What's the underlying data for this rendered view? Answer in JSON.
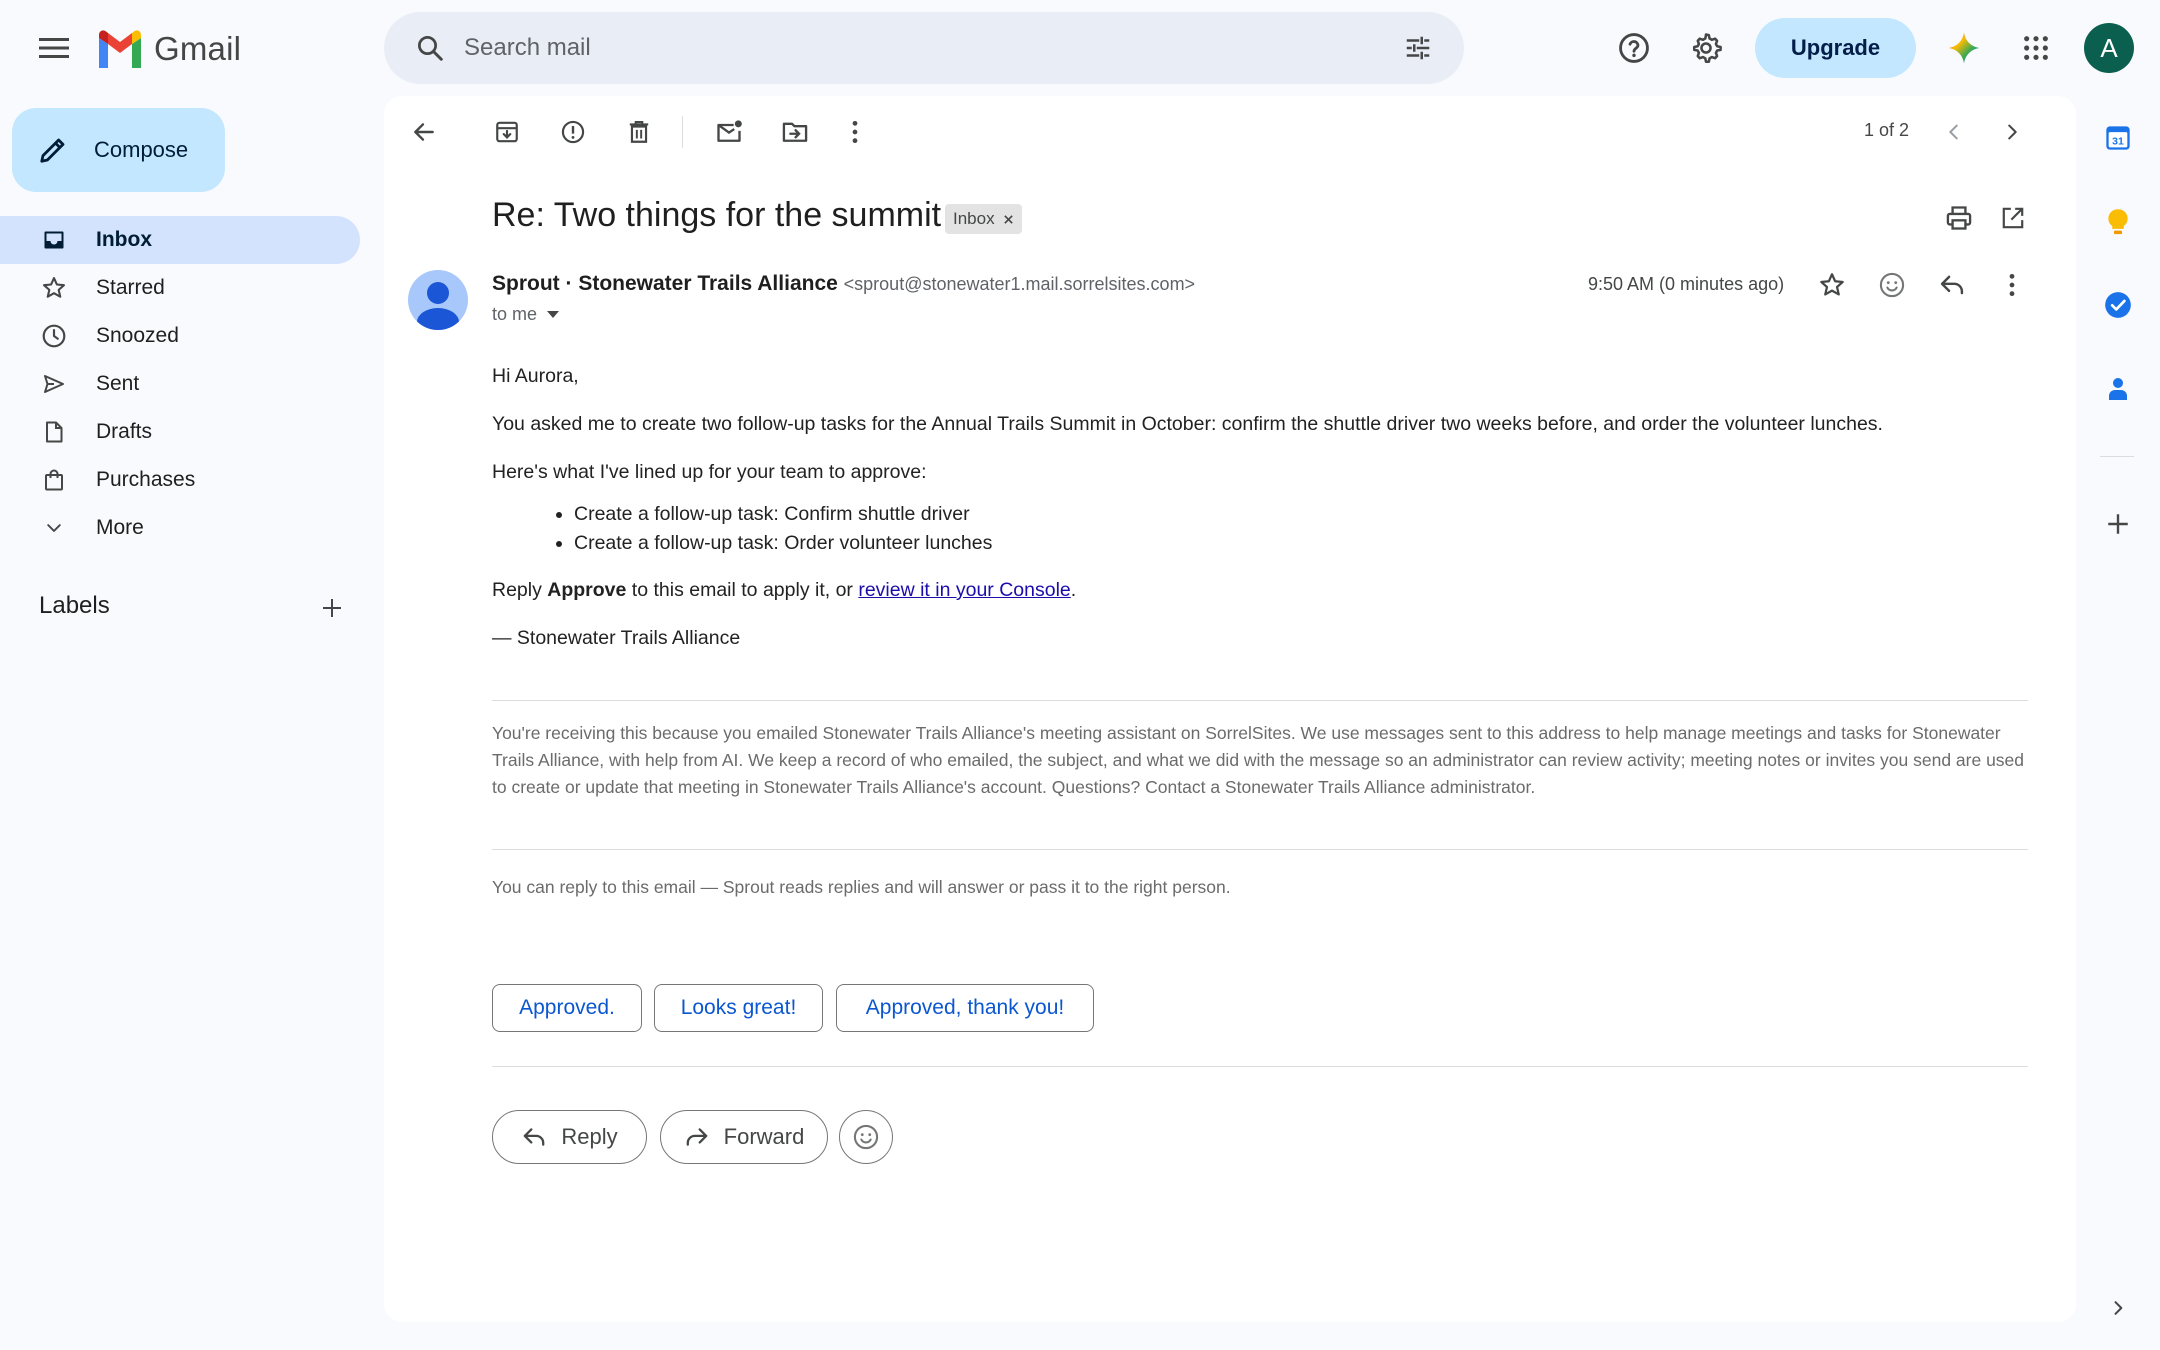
{
  "app": {
    "name": "Gmail"
  },
  "search": {
    "placeholder": "Search mail"
  },
  "header": {
    "upgrade_label": "Upgrade",
    "account_initial": "A"
  },
  "compose": {
    "label": "Compose"
  },
  "nav": {
    "items": [
      {
        "label": "Inbox",
        "icon": "inbox-icon",
        "active": true
      },
      {
        "label": "Starred",
        "icon": "star-icon"
      },
      {
        "label": "Snoozed",
        "icon": "clock-icon"
      },
      {
        "label": "Sent",
        "icon": "send-icon"
      },
      {
        "label": "Drafts",
        "icon": "draft-icon"
      },
      {
        "label": "Purchases",
        "icon": "shopping-bag-icon"
      },
      {
        "label": "More",
        "icon": "chevron-down-icon"
      }
    ],
    "labels_heading": "Labels"
  },
  "toolbar": {
    "pager": "1 of 2"
  },
  "email": {
    "subject": "Re: Two things for the summit",
    "chip": "Inbox",
    "sender_name": "Sprout · Stonewater Trails Alliance",
    "sender_email": "<sprout@stonewater1.mail.sorrelsites.com>",
    "to": "to me",
    "time": "9:50 AM (0 minutes ago)",
    "greeting": "Hi Aurora,",
    "para1": "You asked me to create two follow-up tasks for the Annual Trails Summit in October: confirm the shuttle driver two weeks before, and order the volunteer lunches.",
    "para2": "Here's what I've lined up for your team to approve:",
    "tasks": [
      "Create a follow-up task: Confirm shuttle driver",
      "Create a follow-up task: Order volunteer lunches"
    ],
    "reply_prefix": "Reply ",
    "reply_bold": "Approve",
    "reply_mid": " to this email to apply it, or ",
    "reply_link": "review it in your Console",
    "reply_end": ".",
    "signature": "— Stonewater Trails Alliance",
    "fine_print": "You're receiving this because you emailed Stonewater Trails Alliance's meeting assistant on SorrelSites. We use messages sent to this address to help manage meetings and tasks for Stonewater Trails Alliance, with help from AI. We keep a record of who emailed, the subject, and what we did with the message so an administrator can review activity; meeting notes or invites you send are used to create or update that meeting in Stonewater Trails Alliance's account. Questions? Contact a Stonewater Trails Alliance administrator.",
    "reply_note": "You can reply to this email — Sprout reads replies and will answer or pass it to the right person."
  },
  "smart_replies": [
    "Approved.",
    "Looks great!",
    "Approved, thank you!"
  ],
  "actions": {
    "reply": "Reply",
    "forward": "Forward"
  },
  "rail": {
    "calendar_day": "31"
  },
  "colors": {
    "accent": "#0b57d0",
    "compose_bg": "#c2e7ff",
    "active_nav": "#d3e3fd"
  }
}
